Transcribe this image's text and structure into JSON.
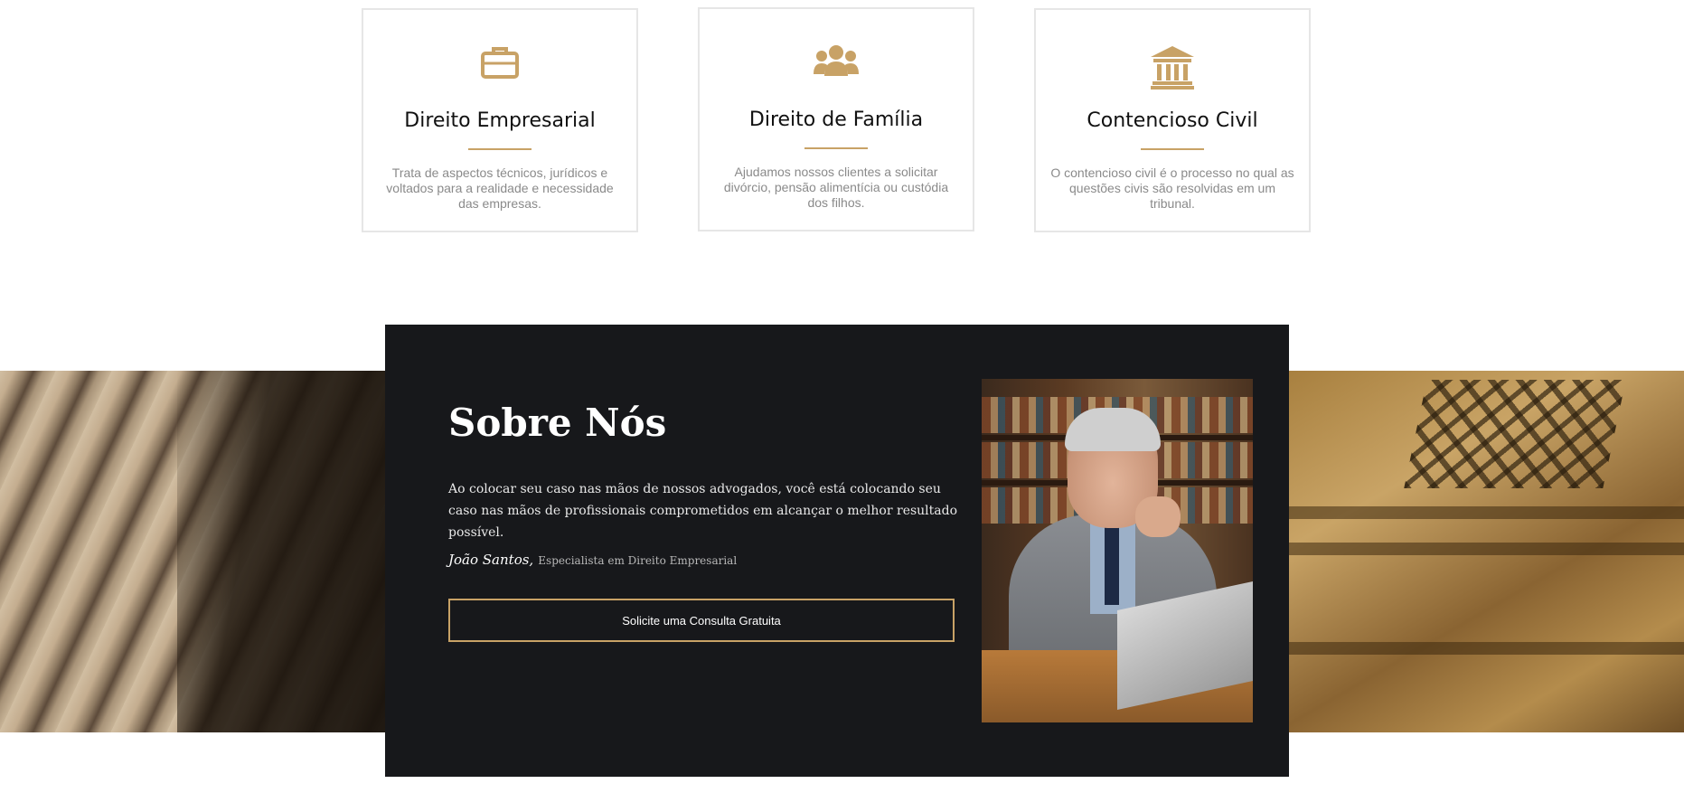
{
  "services": [
    {
      "icon": "briefcase-icon",
      "title": "Direito Empresarial",
      "description": "Trata de aspectos técnicos, jurídicos e voltados para a realidade e necessidade das empresas."
    },
    {
      "icon": "users-icon",
      "title": "Direito de Família",
      "description": "Ajudamos nossos clientes a solicitar divórcio, pensão alimentícia ou custódia dos filhos."
    },
    {
      "icon": "courthouse-icon",
      "title": "Contencioso Civil",
      "description": "O contencioso civil é o processo no qual as questões civis são resolvidas em um tribunal."
    }
  ],
  "about": {
    "heading": "Sobre Nós",
    "text": "Ao colocar seu caso nas mãos de nossos advogados, você está colocando seu caso nas mãos de profissionais comprometidos em alcançar o melhor resultado possível.",
    "author_name": "João Santos,",
    "author_role": "Especialista em Direito Empresarial",
    "cta_label": "Solicite uma Consulta Gratuita"
  },
  "colors": {
    "accent": "#c8a266",
    "panel": "#17181b",
    "card_border": "#e6e6e6"
  }
}
